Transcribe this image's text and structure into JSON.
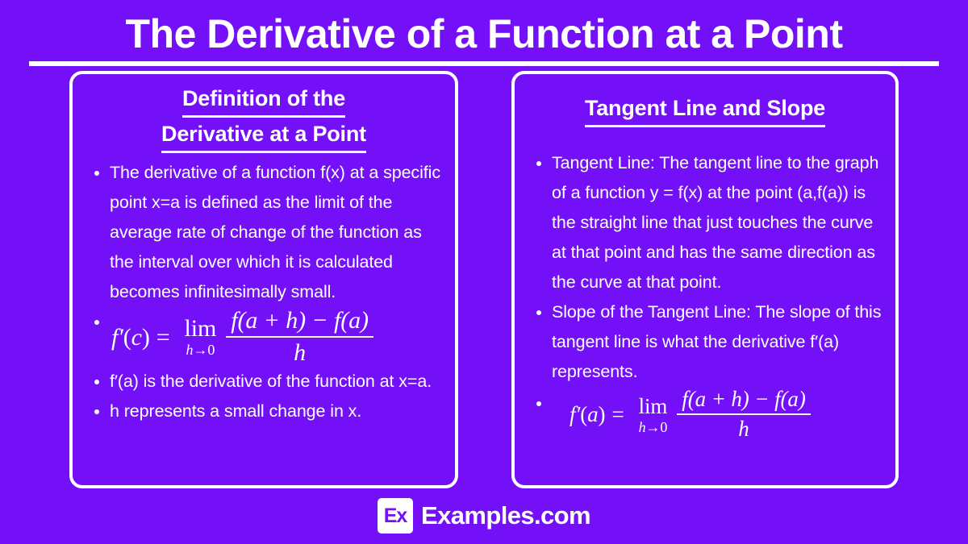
{
  "page": {
    "title": "The Derivative of a Function at a Point",
    "background_color": "#7410f8",
    "text_color": "#ffffff"
  },
  "cards": [
    {
      "heading_lines": [
        "Definition of the",
        "Derivative at a Point"
      ],
      "bullets": [
        "The derivative of a function f(x) at a specific point x=a is defined as the limit of the average rate of change of the function as the interval over which it is calculated becomes infinitesimally small.",
        "f′(a) is the derivative of the function at x=a.",
        "h represents a small change in x."
      ],
      "formula": {
        "lhs_function": "f",
        "lhs_prime": "′",
        "lhs_open": "(",
        "lhs_var": "c",
        "lhs_close": ")",
        "equals": "=",
        "lim": "lim",
        "lim_sub_var": "h",
        "lim_sub_arrow": "→0",
        "numerator": "f(a + h) − f(a)",
        "denominator": "h",
        "plain": "f′(c) = lim(h→0) [f(a+h) − f(a)] / h"
      }
    },
    {
      "heading_lines": [
        "Tangent Line and Slope"
      ],
      "bullets": [
        "Tangent Line: The tangent line to the graph of a function y = f(x) at the point (a,f(a)) is the straight line that just touches the curve at that point and has the same direction as the curve at that point.",
        "Slope of the Tangent Line: The slope of this tangent line is what the derivative f′(a) represents."
      ],
      "formula": {
        "lhs_function": "f",
        "lhs_prime": "′",
        "lhs_open": "(",
        "lhs_var": "a",
        "lhs_close": ")",
        "equals": "=",
        "lim": "lim",
        "lim_sub_var": "h",
        "lim_sub_arrow": "→0",
        "numerator": "f(a + h) − f(a)",
        "denominator": "h",
        "plain": "f′(a) = lim(h→0) [f(a+h) − f(a)] / h"
      }
    }
  ],
  "footer": {
    "logo_mark": "Ex",
    "logo_text": "Examples.com"
  }
}
